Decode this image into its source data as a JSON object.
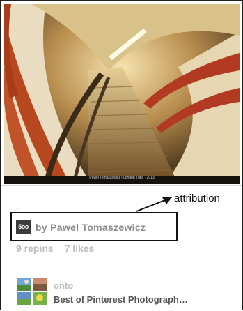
{
  "photo": {
    "caption": "Pawel Tomaszewicz | London Tube · 2013"
  },
  "pin": {
    "description": ".",
    "source_logo": "500px-logo",
    "source_logo_text": "5oo",
    "attribution": "by Pawel Tomaszewicz",
    "repins": "9 repins",
    "likes": "7 likes"
  },
  "annotation": {
    "label": "attribution"
  },
  "board": {
    "onto": "onto",
    "name": "Best of Pinterest Photograph…"
  },
  "colors": {
    "stats": "#bdbdbd",
    "attribution": "#8a8a8a",
    "board_name": "#555555",
    "logo_bg": "#3b3b3b"
  }
}
